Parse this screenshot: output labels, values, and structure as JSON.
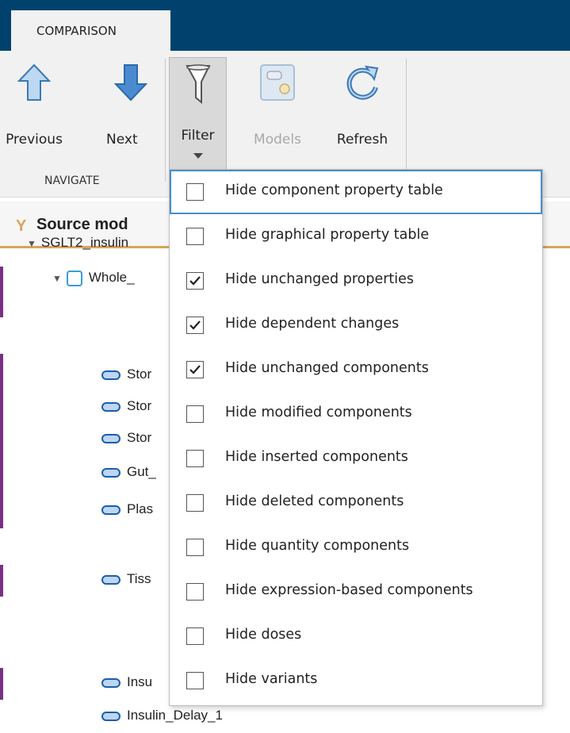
{
  "tab": {
    "label": "COMPARISON"
  },
  "toolbar": {
    "previous_label": "Previous",
    "next_label": "Next",
    "filter_label": "Filter",
    "models_label": "Models",
    "refresh_label": "Refresh",
    "group_navigate": "NAVIGATE"
  },
  "tree": {
    "header_icon": "Y",
    "header_title": "Source mod",
    "rows": [
      {
        "label": "SGLT2_insulin"
      },
      {
        "label": "Whole_"
      },
      {
        "label": "Stor"
      },
      {
        "label": "Stor"
      },
      {
        "label": "Stor"
      },
      {
        "label": "Gut_"
      },
      {
        "label": "Plas"
      },
      {
        "label": "Tiss"
      },
      {
        "label": "Insu"
      },
      {
        "label": "Insulin_Delay_1"
      }
    ]
  },
  "filter_menu": {
    "items": [
      {
        "label": "Hide component property table",
        "checked": false
      },
      {
        "label": "Hide graphical property table",
        "checked": false
      },
      {
        "label": "Hide unchanged properties",
        "checked": true
      },
      {
        "label": "Hide dependent changes",
        "checked": true
      },
      {
        "label": "Hide unchanged components",
        "checked": true
      },
      {
        "label": "Hide modified components",
        "checked": false
      },
      {
        "label": "Hide inserted components",
        "checked": false
      },
      {
        "label": "Hide deleted components",
        "checked": false
      },
      {
        "label": "Hide quantity components",
        "checked": false
      },
      {
        "label": "Hide expression-based components",
        "checked": false
      },
      {
        "label": "Hide doses",
        "checked": false
      },
      {
        "label": "Hide variants",
        "checked": false
      }
    ]
  },
  "colors": {
    "titlebar": "#00426e",
    "accent_purple": "#7a2e86",
    "focus_outline": "#4a8bd0",
    "arrow_blue": "#5b9bd5"
  }
}
